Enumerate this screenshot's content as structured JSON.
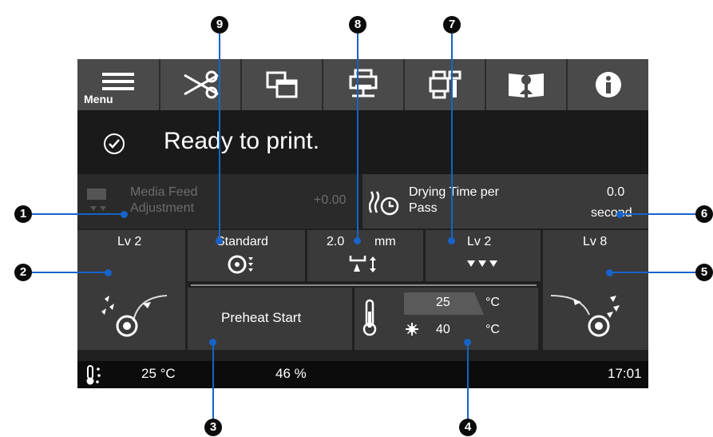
{
  "toolbar": {
    "menu_label": "Menu",
    "icons": [
      "menu-icon",
      "scissors-icon",
      "windows-icon",
      "network-printer-icon",
      "maintenance-icon",
      "manual-icon",
      "info-icon"
    ]
  },
  "status": {
    "message": "Ready to print."
  },
  "media_feed": {
    "label_line1": "Media Feed",
    "label_line2": "Adjustment",
    "value": "+0.00"
  },
  "drying": {
    "label_line1": "Drying Time per",
    "label_line2": "Pass",
    "value": "0.0",
    "unit": "second"
  },
  "feeding_tension": {
    "level": "Lv 2"
  },
  "pass_mode": {
    "value": "Standard"
  },
  "platen_gap": {
    "value": "2.0",
    "unit": "mm"
  },
  "suction": {
    "level": "Lv 2"
  },
  "take_up_tension": {
    "level": "Lv 8"
  },
  "preheat": {
    "label": "Preheat Start"
  },
  "heater": {
    "current": "25",
    "set": "40",
    "unit": "°C"
  },
  "bottom_bar": {
    "temperature": "25 °C",
    "humidity": "46 %",
    "time": "17:01"
  },
  "callouts": [
    "1",
    "2",
    "3",
    "4",
    "5",
    "6",
    "7",
    "8",
    "9"
  ],
  "colors": {
    "callout_line": "#1763c8",
    "screen_bg": "#202020"
  }
}
